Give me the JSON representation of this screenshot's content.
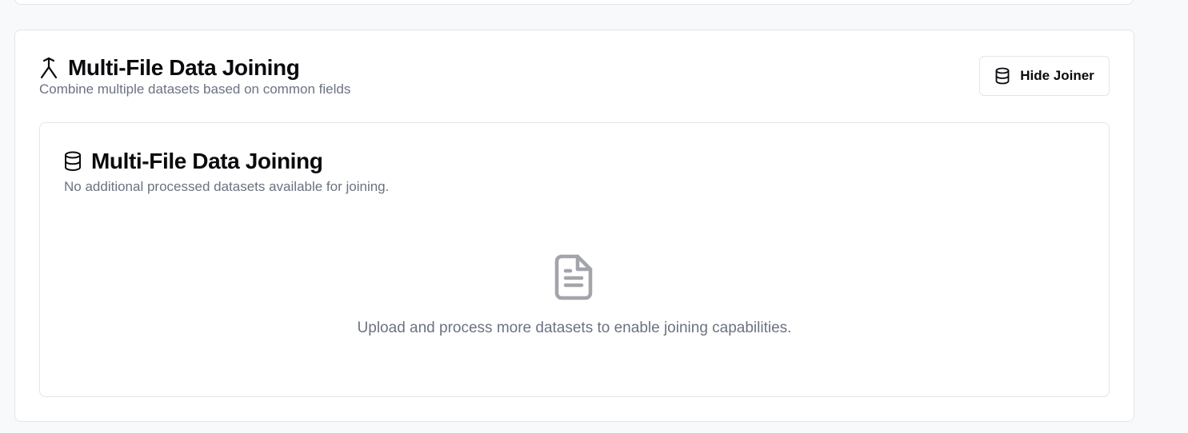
{
  "joiner": {
    "title": "Multi-File Data Joining",
    "subtitle": "Combine multiple datasets based on common fields",
    "title_icon": "merge-icon",
    "hide_button": {
      "label": "Hide Joiner",
      "icon": "database-icon"
    }
  },
  "panel": {
    "title": "Multi-File Data Joining",
    "title_icon": "database-icon",
    "subtitle": "No additional processed datasets available for joining.",
    "empty_state": {
      "icon": "file-text-icon",
      "message": "Upload and process more datasets to enable joining capabilities."
    }
  },
  "colors": {
    "page_background": "#f8f9fa",
    "card_background": "#ffffff",
    "border": "#e4e5e9",
    "heading": "#0b0b0f",
    "muted_text": "#6b7280",
    "empty_icon": "#a3a5ab"
  }
}
